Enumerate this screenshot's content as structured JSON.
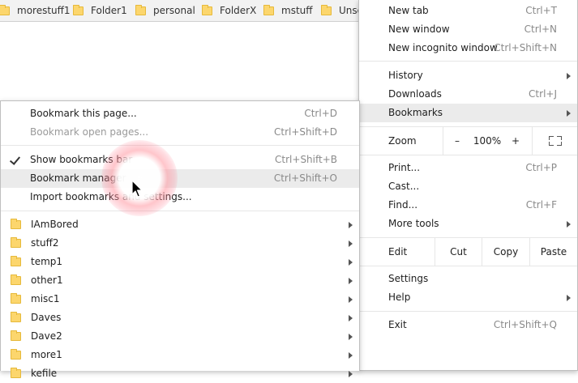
{
  "bookmarks_bar": {
    "items": [
      {
        "label": "morestuff1"
      },
      {
        "label": "Folder1"
      },
      {
        "label": "personal"
      },
      {
        "label": "FolderX"
      },
      {
        "label": "mstuff"
      },
      {
        "label": "Unso"
      }
    ]
  },
  "main_menu": {
    "new_tab": {
      "label": "New tab",
      "shortcut": "Ctrl+T"
    },
    "new_window": {
      "label": "New window",
      "shortcut": "Ctrl+N"
    },
    "new_incognito": {
      "label": "New incognito window",
      "shortcut": "Ctrl+Shift+N"
    },
    "history": {
      "label": "History"
    },
    "downloads": {
      "label": "Downloads",
      "shortcut": "Ctrl+J"
    },
    "bookmarks": {
      "label": "Bookmarks"
    },
    "zoom": {
      "label": "Zoom",
      "minus": "–",
      "value": "100%",
      "plus": "+"
    },
    "print": {
      "label": "Print...",
      "shortcut": "Ctrl+P"
    },
    "cast": {
      "label": "Cast..."
    },
    "find": {
      "label": "Find...",
      "shortcut": "Ctrl+F"
    },
    "more_tools": {
      "label": "More tools"
    },
    "edit": {
      "label": "Edit",
      "cut": "Cut",
      "copy": "Copy",
      "paste": "Paste"
    },
    "settings": {
      "label": "Settings"
    },
    "help": {
      "label": "Help"
    },
    "exit": {
      "label": "Exit",
      "shortcut": "Ctrl+Shift+Q"
    }
  },
  "bookmarks_menu": {
    "bookmark_page": {
      "label": "Bookmark this page...",
      "shortcut": "Ctrl+D"
    },
    "bookmark_open": {
      "label": "Bookmark open pages...",
      "shortcut": "Ctrl+Shift+D"
    },
    "show_bar": {
      "label": "Show bookmarks bar",
      "shortcut": "Ctrl+Shift+B"
    },
    "manager": {
      "label": "Bookmark manager",
      "shortcut": "Ctrl+Shift+O"
    },
    "import": {
      "label": "Import bookmarks and settings..."
    },
    "folders": [
      {
        "label": "IAmBored"
      },
      {
        "label": "stuff2"
      },
      {
        "label": "temp1"
      },
      {
        "label": "other1"
      },
      {
        "label": "misc1"
      },
      {
        "label": "Daves"
      },
      {
        "label": "Dave2"
      },
      {
        "label": "more1"
      },
      {
        "label": "kefile"
      }
    ]
  },
  "colors": {
    "folder": "#fcd66d",
    "highlight": "#ebebeb",
    "click_glow": "#ff8c9a"
  }
}
